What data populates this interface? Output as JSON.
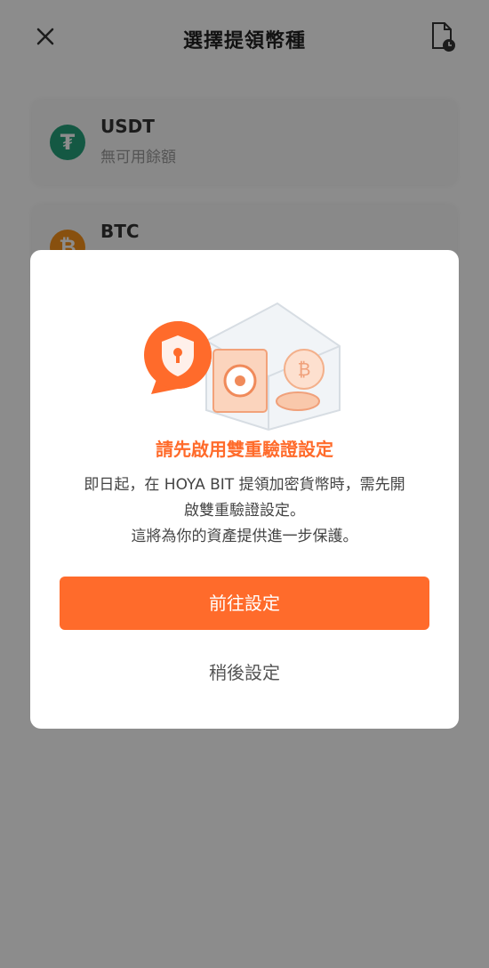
{
  "header": {
    "title": "選擇提領幣種"
  },
  "coins": [
    {
      "symbol": "USDT",
      "balance_text": "無可用餘額",
      "icon_glyph": "₮",
      "color": "#26a17b"
    },
    {
      "symbol": "BTC",
      "icon_glyph": "₿",
      "color": "#f7931a"
    }
  ],
  "modal": {
    "title": "請先啟用雙重驗證設定",
    "body_line1": "即日起，在 HOYA BIT 提領加密貨幣時，需先開",
    "body_line2": "啟雙重驗證設定。",
    "body_line3": "這將為你的資產提供進一步保護。",
    "primary_label": "前往設定",
    "secondary_label": "稍後設定"
  },
  "colors": {
    "accent": "#ff6b2b",
    "overlay": "rgba(0,0,0,0.45)"
  }
}
